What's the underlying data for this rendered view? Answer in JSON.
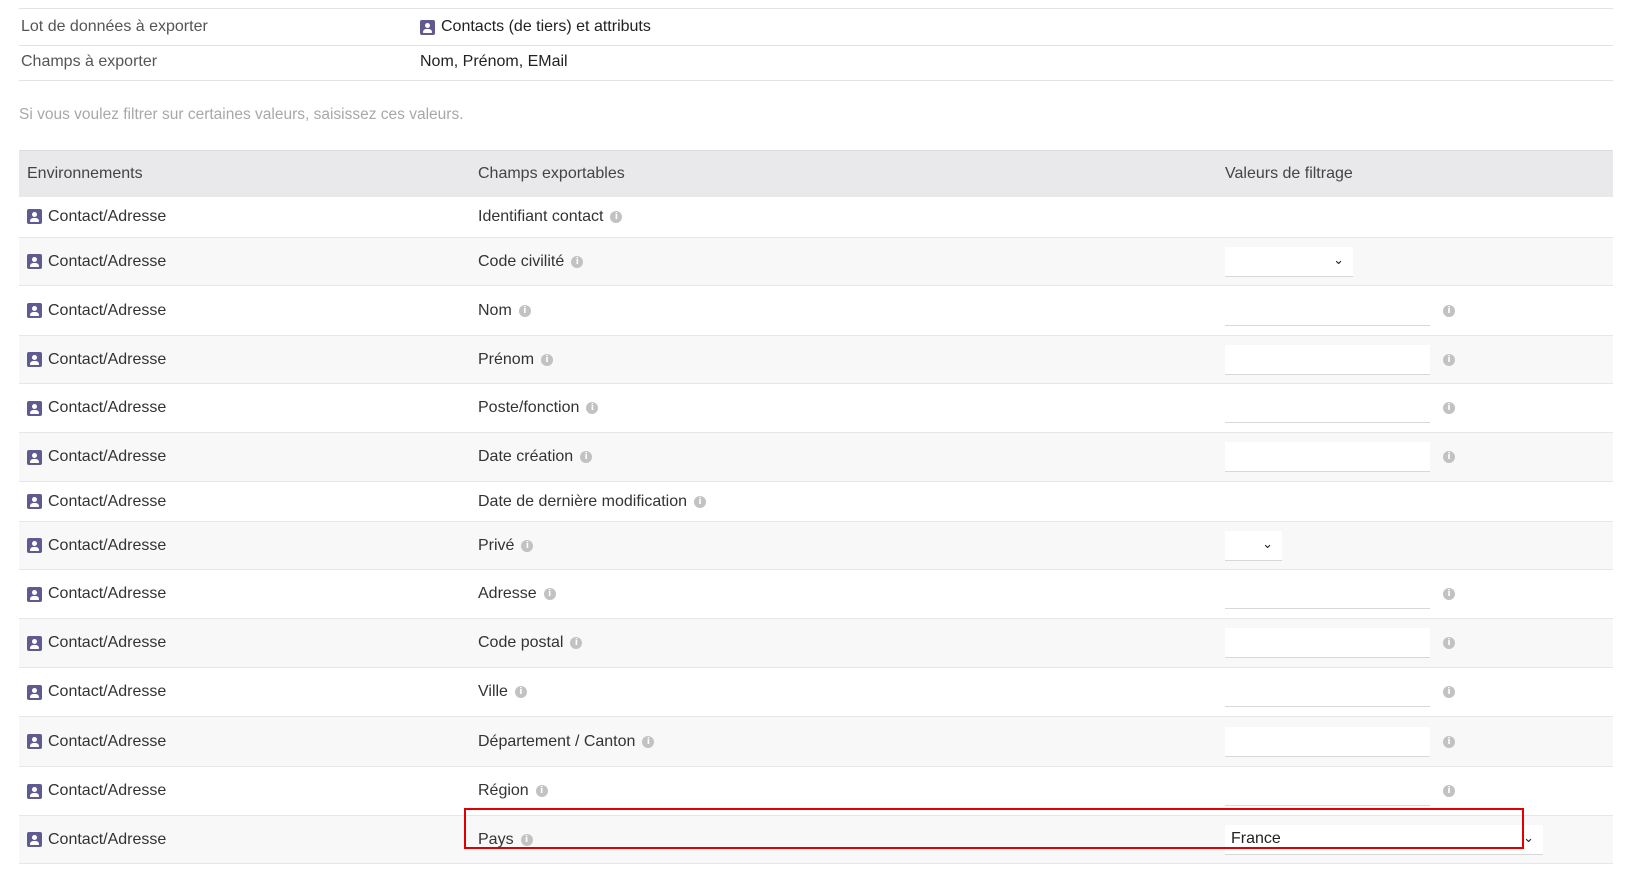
{
  "summary": {
    "dataset_label": "Lot de données à exporter",
    "dataset_value": "Contacts (de tiers) et attributs",
    "fields_label": "Champs à exporter",
    "fields_value": "Nom, Prénom, EMail"
  },
  "filter_hint": "Si vous voulez filtrer sur certaines valeurs, saisissez ces valeurs.",
  "table": {
    "headers": [
      "Environnements",
      "Champs exportables",
      "Valeurs de filtrage"
    ],
    "rows": [
      {
        "env": "Contact/Adresse",
        "field": "Identifiant contact",
        "filter": "none"
      },
      {
        "env": "Contact/Adresse",
        "field": "Code civilité",
        "filter": "select"
      },
      {
        "env": "Contact/Adresse",
        "field": "Nom",
        "filter": "text"
      },
      {
        "env": "Contact/Adresse",
        "field": "Prénom",
        "filter": "text"
      },
      {
        "env": "Contact/Adresse",
        "field": "Poste/fonction",
        "filter": "text"
      },
      {
        "env": "Contact/Adresse",
        "field": "Date création",
        "filter": "text"
      },
      {
        "env": "Contact/Adresse",
        "field": "Date de dernière modification",
        "filter": "none"
      },
      {
        "env": "Contact/Adresse",
        "field": "Privé",
        "filter": "select"
      },
      {
        "env": "Contact/Adresse",
        "field": "Adresse",
        "filter": "text"
      },
      {
        "env": "Contact/Adresse",
        "field": "Code postal",
        "filter": "text"
      },
      {
        "env": "Contact/Adresse",
        "field": "Ville",
        "filter": "text"
      },
      {
        "env": "Contact/Adresse",
        "field": "Département / Canton",
        "filter": "text"
      },
      {
        "env": "Contact/Adresse",
        "field": "Région",
        "filter": "text"
      },
      {
        "env": "Contact/Adresse",
        "field": "Pays",
        "filter": "select",
        "value": "France"
      }
    ]
  },
  "icons": {
    "environment": "contact-card-icon",
    "info": "info-icon",
    "dropdown": "chevron-down-icon"
  },
  "colors": {
    "icon": "#5f5a90",
    "highlight": "#e00000",
    "header_bg": "#e9e9ec"
  }
}
